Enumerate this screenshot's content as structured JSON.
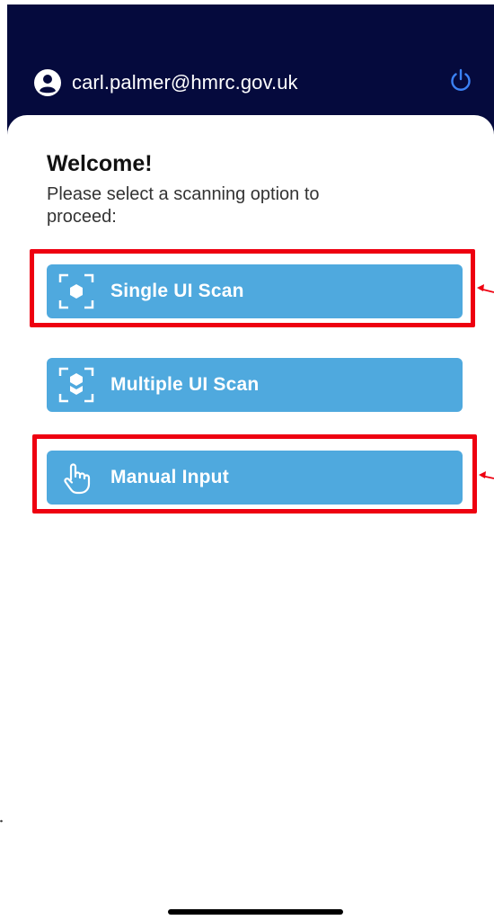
{
  "header": {
    "user_email": "carl.palmer@hmrc.gov.uk"
  },
  "main": {
    "welcome": "Welcome!",
    "subtitle": "Please select a scanning option to proceed:",
    "buttons": [
      {
        "label": "Single UI Scan",
        "icon": "single-scan-icon",
        "highlighted": true
      },
      {
        "label": "Multiple UI Scan",
        "icon": "multiple-scan-icon",
        "highlighted": false
      },
      {
        "label": "Manual Input",
        "icon": "hand-pointer-icon",
        "highlighted": true
      }
    ]
  },
  "colors": {
    "header_bg": "#050a3d",
    "button_bg": "#4fa9de",
    "highlight": "#ee0010",
    "power_icon": "#3b82f6"
  }
}
